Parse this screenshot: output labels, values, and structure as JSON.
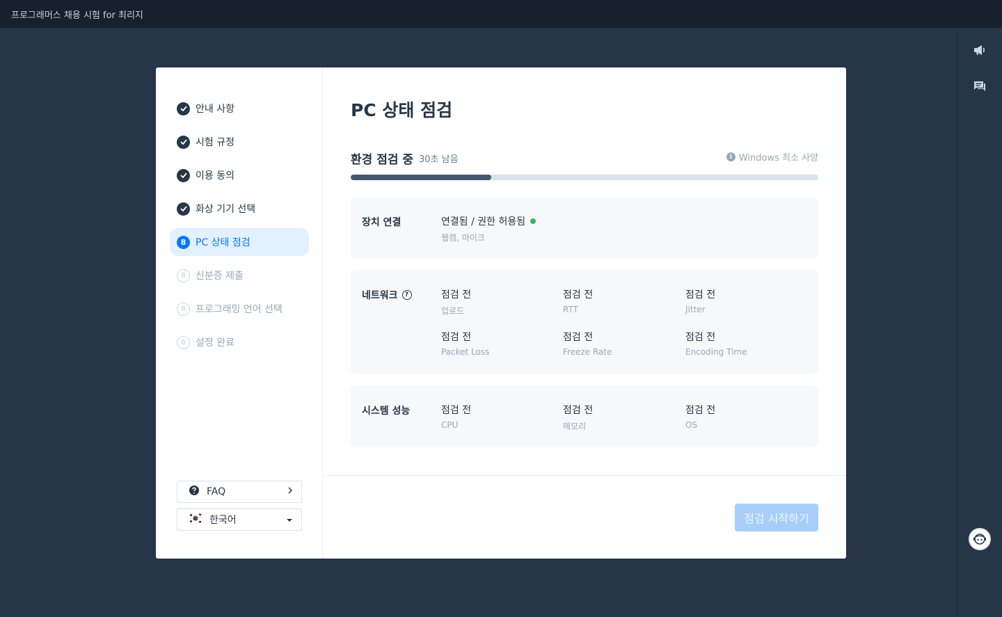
{
  "app": {
    "title": "프로그래머스 채용 시험 for 최리지"
  },
  "rail": {
    "announce_icon": "megaphone-icon",
    "chat_icon": "chat-icon",
    "support_icon": "support-avatar-icon"
  },
  "sidebar": {
    "steps": [
      {
        "label": "안내 사항",
        "status": "done"
      },
      {
        "label": "시험 규정",
        "status": "done"
      },
      {
        "label": "이용 동의",
        "status": "done"
      },
      {
        "label": "화상 기기 선택",
        "status": "done"
      },
      {
        "label": "PC 상태 점검",
        "status": "active",
        "num": "8"
      },
      {
        "label": "신분증 제출",
        "status": "pending",
        "num": "8"
      },
      {
        "label": "프로그래밍 언어 선택",
        "status": "pending",
        "num": "8"
      },
      {
        "label": "설정 완료",
        "status": "pending",
        "num": "8"
      }
    ],
    "faq_label": "FAQ",
    "language_label": "한국어"
  },
  "main": {
    "title": "PC 상태 점검",
    "progress": {
      "title": "환경 점검 중",
      "remaining": "30초 남음",
      "link": "Windows 최소 사양",
      "percent": 30
    },
    "device": {
      "title": "장치 연결",
      "value": "연결됨 / 권한 허용됨",
      "sub": "웹캠, 마이크",
      "status_color": "#3cb35b"
    },
    "network": {
      "title": "네트워크",
      "metrics": [
        {
          "value": "점검 전",
          "label": "업로드"
        },
        {
          "value": "점검 전",
          "label": "RTT"
        },
        {
          "value": "점검 전",
          "label": "Jitter"
        },
        {
          "value": "점검 전",
          "label": "Packet Loss"
        },
        {
          "value": "점검 전",
          "label": "Freeze Rate"
        },
        {
          "value": "점검 전",
          "label": "Encoding Time"
        }
      ]
    },
    "system": {
      "title": "시스템 성능",
      "metrics": [
        {
          "value": "점검 전",
          "label": "CPU"
        },
        {
          "value": "점검 전",
          "label": "메모리"
        },
        {
          "value": "점검 전",
          "label": "OS"
        }
      ]
    },
    "start_button": "점검 시작하기"
  }
}
